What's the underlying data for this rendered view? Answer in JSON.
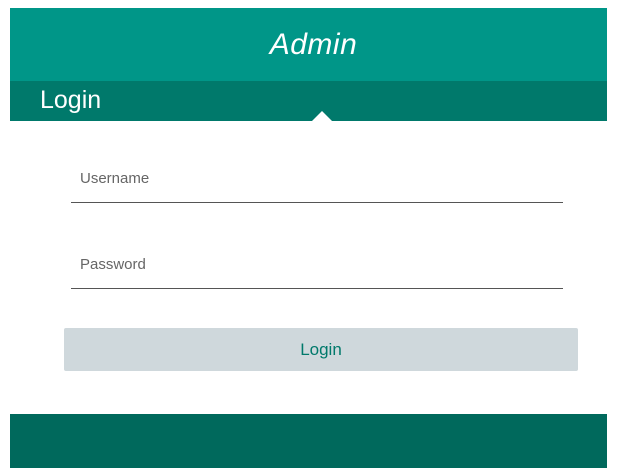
{
  "header": {
    "title": "Admin"
  },
  "subheader": {
    "title": "Login"
  },
  "form": {
    "username": {
      "placeholder": "Username",
      "value": ""
    },
    "password": {
      "placeholder": "Password",
      "value": ""
    },
    "submit_label": "Login"
  },
  "colors": {
    "header": "#009688",
    "subheader": "#00796b",
    "button_bg": "#cfd8dc",
    "button_text": "#00796b",
    "footer": "#00695c"
  }
}
